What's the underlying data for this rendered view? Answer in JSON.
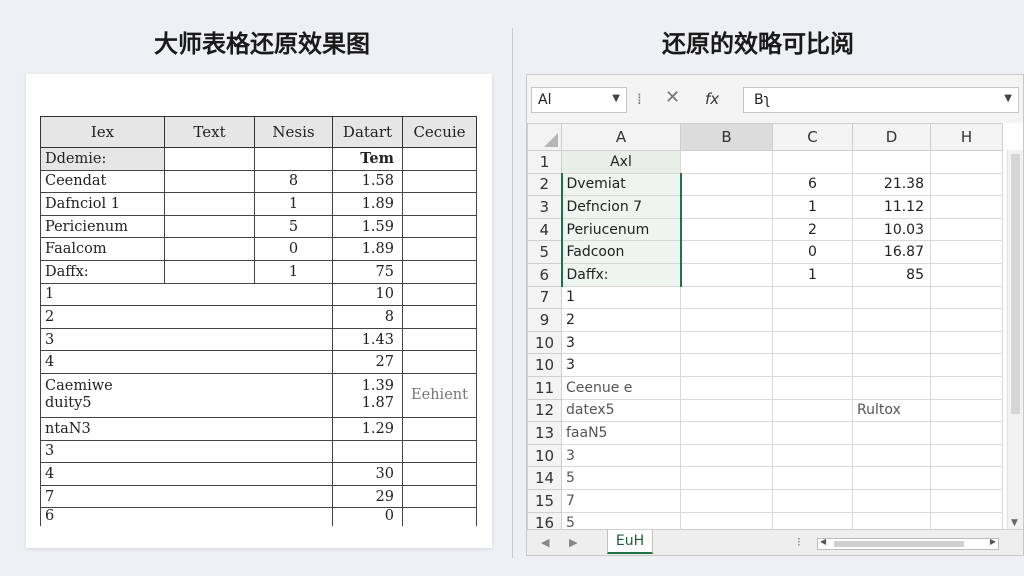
{
  "titles": {
    "left": "大师表格还原效果图",
    "right": "还原的效略可比阅"
  },
  "paper_table": {
    "headers": [
      "Iex",
      "Text",
      "Nesis",
      "Datart",
      "Cecuie"
    ],
    "rows": [
      [
        "Ddemie:",
        "",
        "",
        "Tem",
        ""
      ],
      [
        "Ceendat",
        "",
        "8",
        "1.58",
        ""
      ],
      [
        "Dafnciol 1",
        "",
        "1",
        "1.89",
        ""
      ],
      [
        "Pericienum",
        "",
        "5",
        "1.59",
        ""
      ],
      [
        "Faalcom",
        "",
        "0",
        "1.89",
        ""
      ],
      [
        "Daffx:",
        "",
        "1",
        "75",
        ""
      ]
    ],
    "wide_rows": [
      [
        "1",
        "10"
      ],
      [
        "2",
        "8"
      ],
      [
        "3",
        "1.43"
      ],
      [
        "4",
        "27"
      ]
    ],
    "tall_row": {
      "label_1": "Caemiwe",
      "label_2": "duity5",
      "val_1": "1.39",
      "val_2": "1.87",
      "note": "Eehient"
    },
    "wide_rows_2": [
      [
        "ntaN3",
        "1.29"
      ],
      [
        "3",
        ""
      ],
      [
        "4",
        "30"
      ],
      [
        "7",
        "29"
      ],
      [
        "6",
        "0"
      ]
    ]
  },
  "sheet": {
    "name_box": "Al",
    "formula_icon": "fx",
    "formula_value": "Bʅ",
    "columns": [
      "A",
      "B",
      "C",
      "D",
      "H"
    ],
    "rows": [
      {
        "h": "1",
        "A": "Axl",
        "B": "",
        "C": "",
        "D": "",
        "H": ""
      },
      {
        "h": "2",
        "A": "Dvemiat",
        "B": "",
        "C": "6",
        "D": "21.38",
        "H": ""
      },
      {
        "h": "3",
        "A": "Defncion 7",
        "B": "",
        "C": "1",
        "D": "11.12",
        "H": ""
      },
      {
        "h": "4",
        "A": "Periucenum",
        "B": "",
        "C": "2",
        "D": "10.03",
        "H": ""
      },
      {
        "h": "5",
        "A": "Fadcoon",
        "B": "",
        "C": "0",
        "D": "16.87",
        "H": ""
      },
      {
        "h": "6",
        "A": "Daffx:",
        "B": "",
        "C": "1",
        "D": "85",
        "H": ""
      },
      {
        "h": "7",
        "A": "1",
        "B": "",
        "C": "",
        "D": "",
        "H": ""
      },
      {
        "h": "9",
        "A": "2",
        "B": "",
        "C": "",
        "D": "",
        "H": ""
      },
      {
        "h": "10",
        "A": "3",
        "B": "",
        "C": "",
        "D": "",
        "H": ""
      },
      {
        "h": "10",
        "A": "3",
        "B": "",
        "C": "",
        "D": "",
        "H": ""
      },
      {
        "h": "11",
        "A": "Ceenue e",
        "B": "",
        "C": "",
        "D": "",
        "H": ""
      },
      {
        "h": "12",
        "A": "datex5",
        "B": "",
        "C": "",
        "D": "Rultox",
        "H": ""
      },
      {
        "h": "13",
        "A": "faaN5",
        "B": "",
        "C": "",
        "D": "",
        "H": ""
      },
      {
        "h": "10",
        "A": "3",
        "B": "",
        "C": "",
        "D": "",
        "H": ""
      },
      {
        "h": "14",
        "A": "5",
        "B": "",
        "C": "",
        "D": "",
        "H": ""
      },
      {
        "h": "15",
        "A": "7",
        "B": "",
        "C": "",
        "D": "",
        "H": ""
      },
      {
        "h": "16",
        "A": "5",
        "B": "",
        "C": "",
        "D": "",
        "H": ""
      }
    ],
    "sheet_tab": "EuH",
    "status_dots": "⁝"
  }
}
